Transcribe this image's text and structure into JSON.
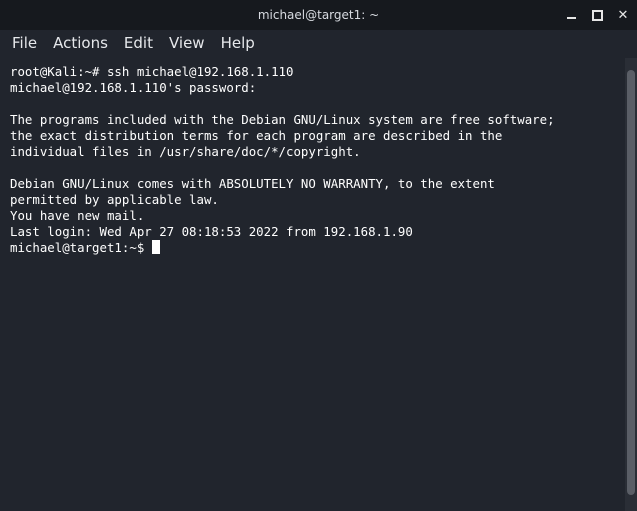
{
  "window": {
    "title": "michael@target1: ~",
    "controls": [
      "minimize-icon",
      "maximize-icon",
      "close-icon"
    ]
  },
  "menu": {
    "items": [
      {
        "label": "File"
      },
      {
        "label": "Actions"
      },
      {
        "label": "Edit"
      },
      {
        "label": "View"
      },
      {
        "label": "Help"
      }
    ]
  },
  "terminal": {
    "lines": [
      "root@Kali:~# ssh michael@192.168.1.110",
      "michael@192.168.1.110's password:",
      "",
      "The programs included with the Debian GNU/Linux system are free software;",
      "the exact distribution terms for each program are described in the",
      "individual files in /usr/share/doc/*/copyright.",
      "",
      "Debian GNU/Linux comes with ABSOLUTELY NO WARRANTY, to the extent",
      "permitted by applicable law.",
      "You have new mail.",
      "Last login: Wed Apr 27 08:18:53 2022 from 192.168.1.90"
    ],
    "prompt": "michael@target1:~$ "
  },
  "colors": {
    "background": "#21252d",
    "titlebar": "#16191e",
    "text": "#ffffff"
  }
}
